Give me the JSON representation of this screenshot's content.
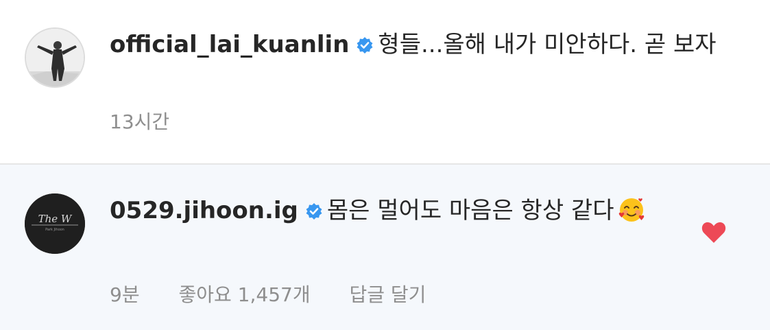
{
  "comments": [
    {
      "username": "official_lai_kuanlin",
      "verified": true,
      "text": "형들...올해 내가 미안하다. 곧 보자",
      "time": "13시간",
      "avatar_icon": "person-photo-avatar"
    },
    {
      "username": "0529.jihoon.ig",
      "verified": true,
      "text": "몸은 멀어도 마음은 항상 같다",
      "emoji_icon": "smiling-face-with-hearts-icon",
      "time": "9분",
      "likes_label": "좋아요 1,457개",
      "reply_label": "답글 달기",
      "avatar_icon": "the-w-logo-avatar",
      "avatar_logo_text": "The W",
      "avatar_logo_subtext": "Park Jihoon",
      "liked": true,
      "heart_color": "#ed4956"
    }
  ],
  "accent_color": "#3897f0"
}
